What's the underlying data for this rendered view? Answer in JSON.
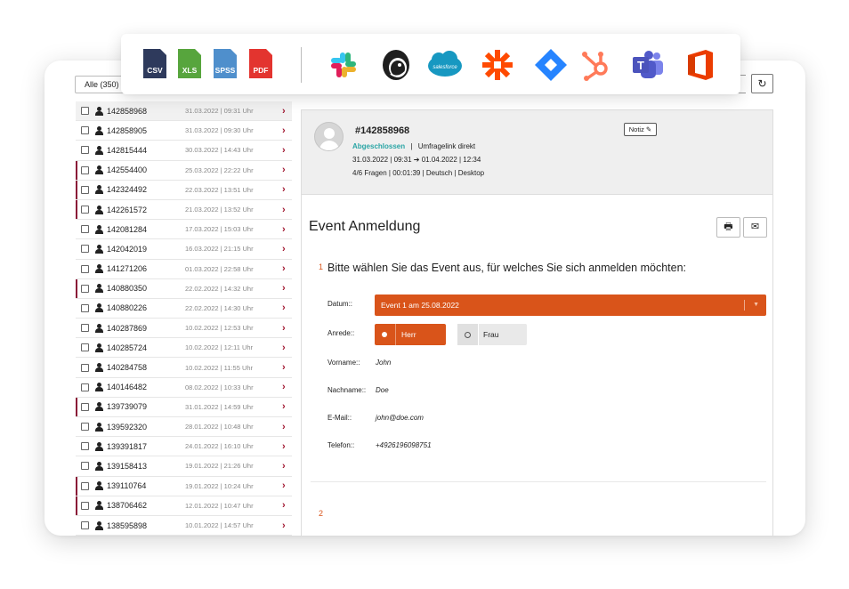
{
  "filter": {
    "label": "Alle (350)"
  },
  "refresh_glyph": "↻",
  "export": [
    {
      "label": "CSV",
      "color": "#2e3a5c"
    },
    {
      "label": "XLS",
      "color": "#57a53d"
    },
    {
      "label": "SPSS",
      "color": "#4f8fcc"
    },
    {
      "label": "PDF",
      "color": "#e3342f"
    }
  ],
  "integrations": [
    "slack-icon",
    "mailchimp-icon",
    "salesforce-icon",
    "zapier-icon",
    "jira-icon",
    "hubspot-icon",
    "teams-icon",
    "office-icon"
  ],
  "salesforce_text": "salesforce",
  "responses": [
    {
      "id": "142858968",
      "date": "31.03.2022 | 09:31 Uhr",
      "mark": false,
      "selected": true
    },
    {
      "id": "142858905",
      "date": "31.03.2022 | 09:30 Uhr",
      "mark": false,
      "selected": false
    },
    {
      "id": "142815444",
      "date": "30.03.2022 | 14:43 Uhr",
      "mark": false,
      "selected": false
    },
    {
      "id": "142554400",
      "date": "25.03.2022 | 22:22 Uhr",
      "mark": true,
      "selected": false
    },
    {
      "id": "142324492",
      "date": "22.03.2022 | 13:51 Uhr",
      "mark": true,
      "selected": false
    },
    {
      "id": "142261572",
      "date": "21.03.2022 | 13:52 Uhr",
      "mark": true,
      "selected": false
    },
    {
      "id": "142081284",
      "date": "17.03.2022 | 15:03 Uhr",
      "mark": false,
      "selected": false
    },
    {
      "id": "142042019",
      "date": "16.03.2022 | 21:15 Uhr",
      "mark": false,
      "selected": false
    },
    {
      "id": "141271206",
      "date": "01.03.2022 | 22:58 Uhr",
      "mark": false,
      "selected": false
    },
    {
      "id": "140880350",
      "date": "22.02.2022 | 14:32 Uhr",
      "mark": true,
      "selected": false
    },
    {
      "id": "140880226",
      "date": "22.02.2022 | 14:30 Uhr",
      "mark": false,
      "selected": false
    },
    {
      "id": "140287869",
      "date": "10.02.2022 | 12:53 Uhr",
      "mark": false,
      "selected": false
    },
    {
      "id": "140285724",
      "date": "10.02.2022 | 12:11 Uhr",
      "mark": false,
      "selected": false
    },
    {
      "id": "140284758",
      "date": "10.02.2022 | 11:55 Uhr",
      "mark": false,
      "selected": false
    },
    {
      "id": "140146482",
      "date": "08.02.2022 | 10:33 Uhr",
      "mark": false,
      "selected": false
    },
    {
      "id": "139739079",
      "date": "31.01.2022 | 14:59 Uhr",
      "mark": true,
      "selected": false
    },
    {
      "id": "139592320",
      "date": "28.01.2022 | 10:48 Uhr",
      "mark": false,
      "selected": false
    },
    {
      "id": "139391817",
      "date": "24.01.2022 | 16:10 Uhr",
      "mark": false,
      "selected": false
    },
    {
      "id": "139158413",
      "date": "19.01.2022 | 21:26 Uhr",
      "mark": false,
      "selected": false
    },
    {
      "id": "139110764",
      "date": "19.01.2022 | 10:24 Uhr",
      "mark": true,
      "selected": false
    },
    {
      "id": "138706462",
      "date": "12.01.2022 | 10:47 Uhr",
      "mark": true,
      "selected": false
    },
    {
      "id": "138595898",
      "date": "10.01.2022 | 14:57 Uhr",
      "mark": false,
      "selected": false
    }
  ],
  "detail": {
    "id": "#142858968",
    "status": "Abgeschlossen",
    "status_sep": "|",
    "source": "Umfragelink direkt",
    "timeline": "31.03.2022 | 09:31 ➔ 01.04.2022 | 12:34",
    "stats": "4/6 Fragen | 00:01:39 | Deutsch | Desktop",
    "note_label": "Notiz ✎",
    "print_glyph": "🖶",
    "mail_glyph": "✉"
  },
  "survey": {
    "title": "Event Anmeldung",
    "q1_num": "1",
    "q1_text": "Bitte wählen Sie das Event aus, für welches Sie sich anmelden möchten:",
    "q2_num": "2",
    "datum_label": "Datum::",
    "datum_value": "Event 1 am 25.08.2022",
    "anrede_label": "Anrede::",
    "anrede_options": [
      "Herr",
      "Frau"
    ],
    "vorname_label": "Vorname::",
    "vorname_value": "John",
    "nachname_label": "Nachname::",
    "nachname_value": "Doe",
    "email_label": "E-Mail::",
    "email_value": "john@doe.com",
    "telefon_label": "Telefon::",
    "telefon_value": "+4926196098751"
  },
  "colors": {
    "accent": "#d9541a",
    "mark": "#8a1537",
    "status": "#2aa5a5"
  }
}
